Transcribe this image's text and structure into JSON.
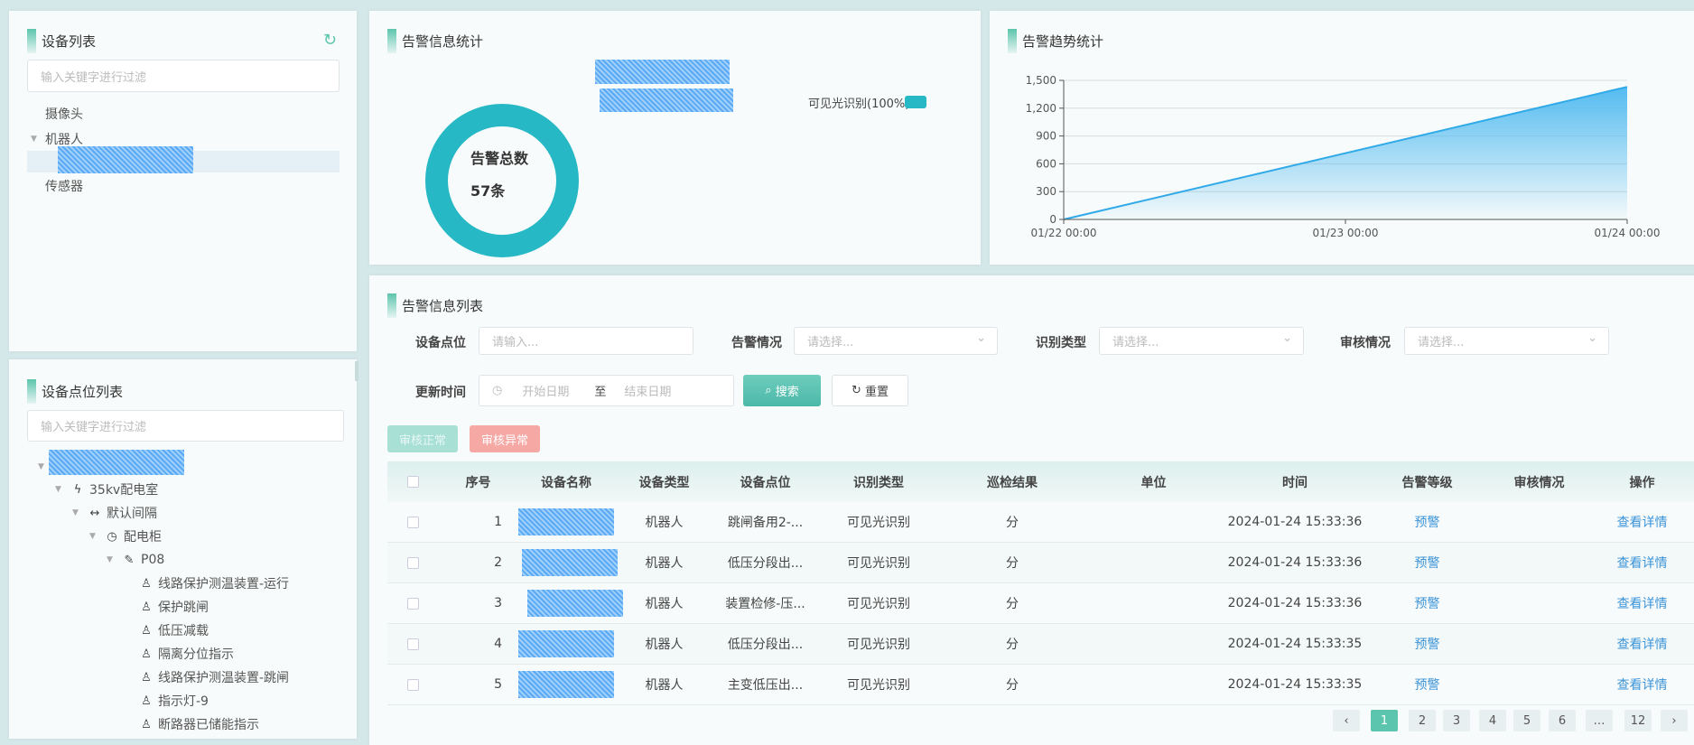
{
  "device_list": {
    "title": "设备列表",
    "filter_placeholder": "输入关键字进行过滤",
    "items": [
      "摄像头",
      "机器人",
      "传感器"
    ]
  },
  "point_list": {
    "title": "设备点位列表",
    "filter_placeholder": "输入关键字进行过滤",
    "tree": [
      {
        "label": "35kv配电室",
        "icon": "lightning-icon",
        "glyph": "ϟ",
        "level": 1
      },
      {
        "label": "默认间隔",
        "icon": "interval-icon",
        "glyph": "↔",
        "level": 2
      },
      {
        "label": "配电柜",
        "icon": "clock-icon",
        "glyph": "◷",
        "level": 3
      },
      {
        "label": "P08",
        "icon": "device-icon",
        "glyph": "✎",
        "level": 4
      },
      {
        "label": "线路保护测温装置-运行",
        "icon": "point-icon",
        "glyph": "♙",
        "level": 5
      },
      {
        "label": "保护跳闸",
        "icon": "point-icon",
        "glyph": "♙",
        "level": 5
      },
      {
        "label": "低压减载",
        "icon": "point-icon",
        "glyph": "♙",
        "level": 5
      },
      {
        "label": "隔离分位指示",
        "icon": "point-icon",
        "glyph": "♙",
        "level": 5
      },
      {
        "label": "线路保护测温装置-跳闸",
        "icon": "point-icon",
        "glyph": "♙",
        "level": 5
      },
      {
        "label": "指示灯-9",
        "icon": "point-icon",
        "glyph": "♙",
        "level": 5
      },
      {
        "label": "断路器已储能指示",
        "icon": "point-icon",
        "glyph": "♙",
        "level": 5
      }
    ]
  },
  "alarm_stats": {
    "title": "告警信息统计",
    "center_label": "告警总数",
    "total": "57条",
    "legend": "可见光识别(100%)",
    "color": "#26b8c4"
  },
  "trend": {
    "title": "告警趋势统计"
  },
  "chart_data": {
    "type": "area",
    "title": "告警趋势统计",
    "x": [
      "01/22 00:00",
      "01/23 00:00",
      "01/24 00:00"
    ],
    "points": [
      [
        0,
        0
      ],
      [
        2,
        1430
      ]
    ],
    "yticks": [
      0,
      300,
      600,
      900,
      1200,
      1500
    ],
    "ytick_labels": [
      "0",
      "300",
      "600",
      "900",
      "1,200",
      "1,500"
    ],
    "ylim": [
      0,
      1500
    ],
    "grid": true,
    "color": "#4bb8ef"
  },
  "alarm_list": {
    "title": "告警信息列表",
    "filters": {
      "point_label": "设备点位",
      "point_placeholder": "请输入...",
      "alarm_label": "告警情况",
      "alarm_placeholder": "请选择...",
      "type_label": "识别类型",
      "type_placeholder": "请选择...",
      "review_label": "审核情况",
      "review_placeholder": "请选择...",
      "time_label": "更新时间",
      "start_placeholder": "开始日期",
      "to": "至",
      "end_placeholder": "结束日期",
      "search": "搜索",
      "reset": "重置"
    },
    "actions": {
      "approve": "审核正常",
      "reject": "审核异常"
    },
    "columns": [
      "",
      "序号",
      "设备名称",
      "设备类型",
      "设备点位",
      "识别类型",
      "巡检结果",
      "单位",
      "时间",
      "告警等级",
      "审核情况",
      "操作"
    ],
    "rows": [
      {
        "no": "1",
        "type": "机器人",
        "point": "跳闸备用2-...",
        "recog": "可见光识别",
        "result": "分",
        "unit": "",
        "time": "2024-01-24 15:33:36",
        "level": "预警",
        "review": "",
        "op": "查看详情"
      },
      {
        "no": "2",
        "type": "机器人",
        "point": "低压分段出...",
        "recog": "可见光识别",
        "result": "分",
        "unit": "",
        "time": "2024-01-24 15:33:36",
        "level": "预警",
        "review": "",
        "op": "查看详情"
      },
      {
        "no": "3",
        "type": "机器人",
        "point": "装置检修-压...",
        "recog": "可见光识别",
        "result": "分",
        "unit": "",
        "time": "2024-01-24 15:33:36",
        "level": "预警",
        "review": "",
        "op": "查看详情"
      },
      {
        "no": "4",
        "type": "机器人",
        "point": "低压分段出...",
        "recog": "可见光识别",
        "result": "分",
        "unit": "",
        "time": "2024-01-24 15:33:35",
        "level": "预警",
        "review": "",
        "op": "查看详情"
      },
      {
        "no": "5",
        "type": "机器人",
        "point": "主变低压出...",
        "recog": "可见光识别",
        "result": "分",
        "unit": "",
        "time": "2024-01-24 15:33:35",
        "level": "预警",
        "review": "",
        "op": "查看详情"
      }
    ],
    "pagination": {
      "prev": "‹",
      "pages": [
        "1",
        "2",
        "3",
        "4",
        "5",
        "6",
        "…",
        "12"
      ],
      "current": "1",
      "next": "›"
    }
  }
}
